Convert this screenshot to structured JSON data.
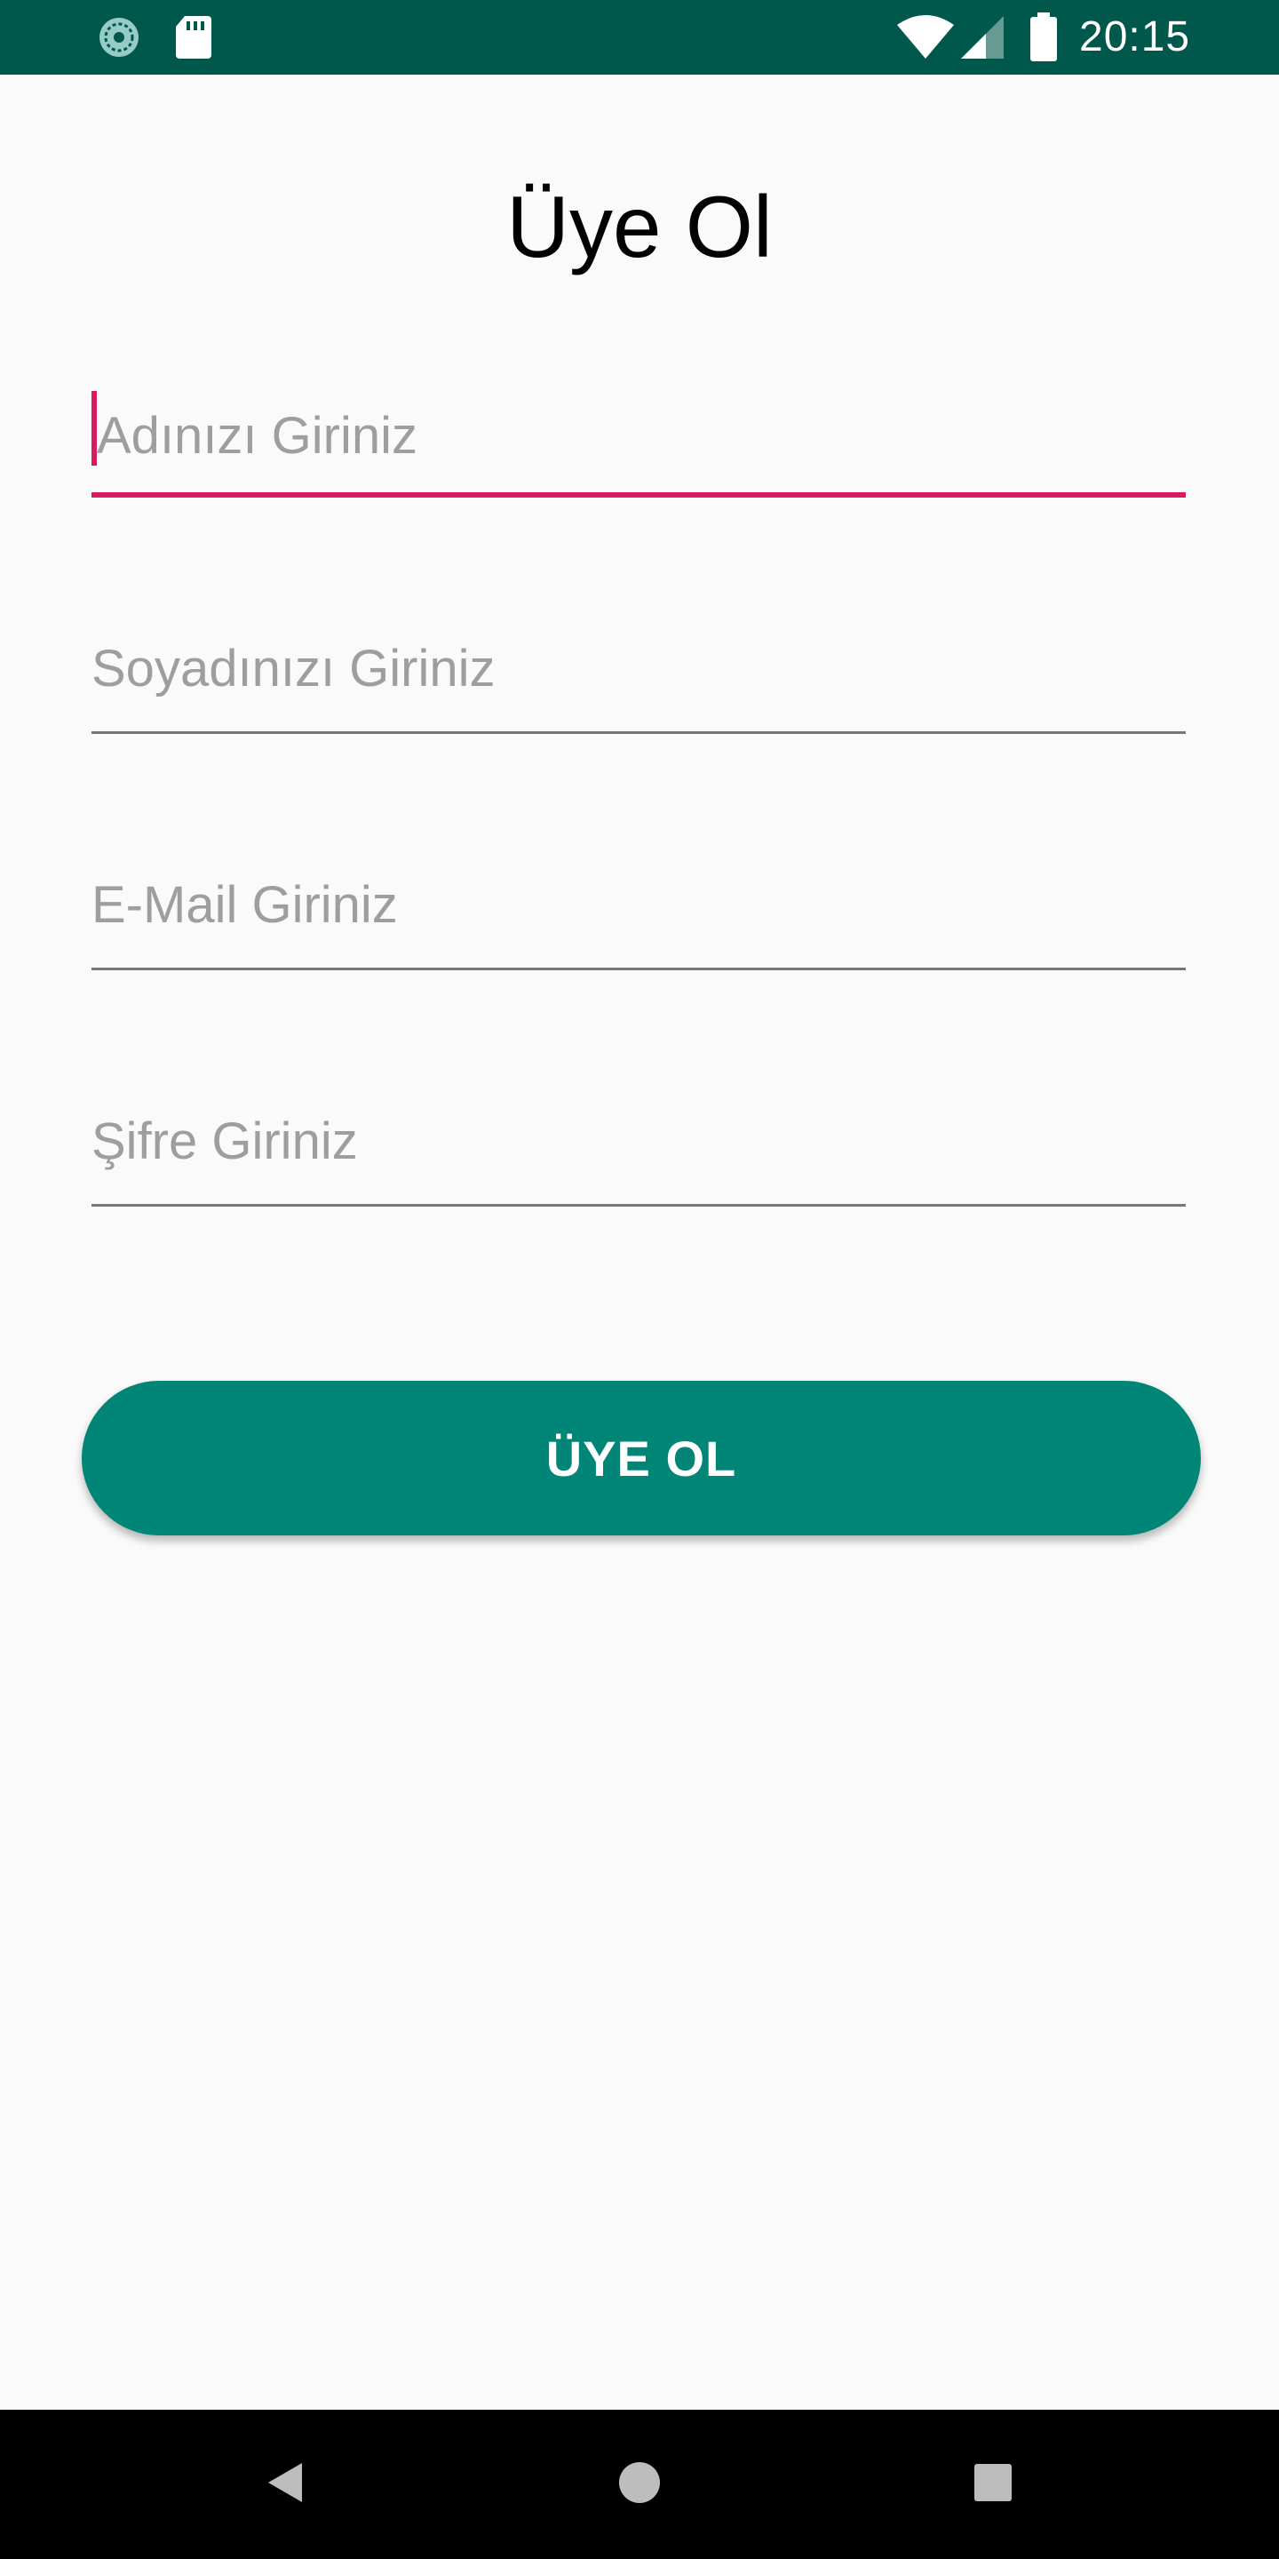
{
  "status_bar": {
    "time": "20:15",
    "left_icons": [
      "sync-icon",
      "sd-card-icon"
    ],
    "right_icons": [
      "wifi-icon",
      "signal-icon",
      "battery-icon"
    ],
    "background_color": "#00574B"
  },
  "page": {
    "title": "Üye Ol"
  },
  "form": {
    "fields": [
      {
        "name": "first-name",
        "placeholder": "Adınızı Giriniz",
        "value": "",
        "focused": true
      },
      {
        "name": "last-name",
        "placeholder": "Soyadınızı Giriniz",
        "value": ""
      },
      {
        "name": "email",
        "placeholder": "E-Mail Giriniz",
        "value": ""
      },
      {
        "name": "password",
        "placeholder": "Şifre Giriniz",
        "value": ""
      }
    ],
    "submit_label": "ÜYE OL",
    "accent_color": "#D81B60",
    "button_color": "#008577"
  },
  "nav_bar": {
    "buttons": [
      "back-icon",
      "home-icon",
      "recents-icon"
    ]
  }
}
